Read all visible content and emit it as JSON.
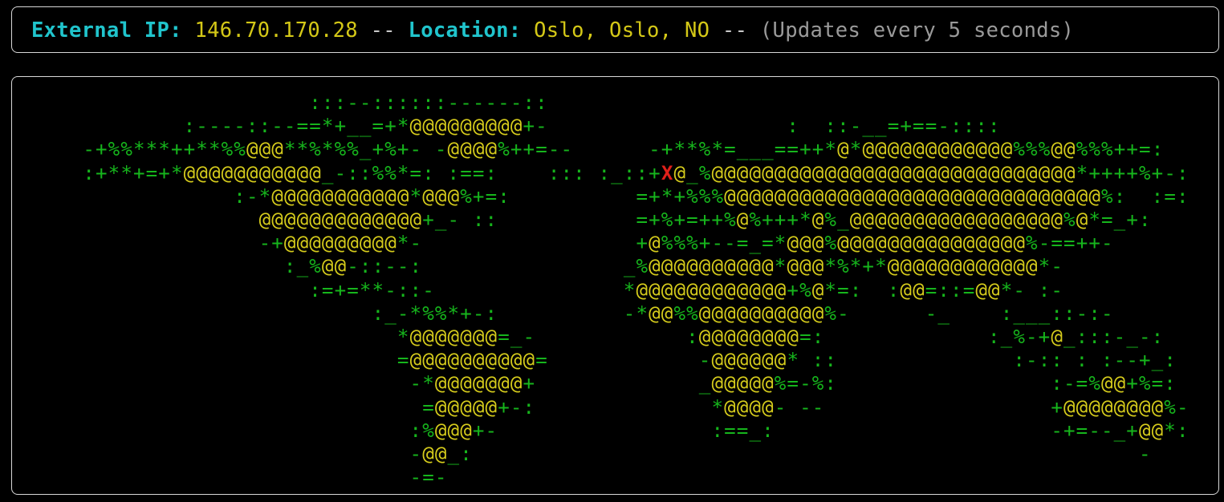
{
  "status": {
    "ip_label": "External IP:",
    "ip_value": "146.70.170.28",
    "separator": "--",
    "location_label": "Location:",
    "location_value": "Oslo, Oslo, NO",
    "separator2": "--",
    "update_note": "(Updates every 5 seconds)"
  },
  "map": {
    "marker": "X",
    "lines": [
      "                    :::--::::::------::",
      "          :----::--==*+__=+*@@@@@@@@@+-                   :  ::-__=+==-::::",
      "  -+%%***++**%%@@@**%*%%_+%+- -@@@@%++=--      -+**%*=___==++*@*@@@@@@@@@@@@%%%@@%%%++=:",
      "  :+**+=+*@@@@@@@@@@@_-::%%*=: :==:    ::: :_::+X@_%@@@@@@@@@@@@@@@@@@@@@@@@@@@@@*++++%+-:",
      "              :-*@@@@@@@@@@@*@@@%+=:          =+*+%%%@@@@@@@@@@@@@@@@@@@@@@@@@@@@@@%:  :=:",
      "                @@@@@@@@@@@@@+_- ::           =+%+=++%@%+++*@%_@@@@@@@@@@@@@@@@@%@*=_+:",
      "                -+@@@@@@@@@*-                 +@%%%+--=_=*@@@%@@@@@@@@@@@@@@@%-==++-",
      "                  :_%@@-::--:                _%@@@@@@@@@@*@@@*%*+*@@@@@@@@@@@@*-",
      "                    :=+=**-::-               *@@@@@@@@@@@@+%@*=:  :@@=::=@@*- :-",
      "                         :_-*%%*+-:          -*@@%%@@@@@@@@@@%-      -_    :___::-:-",
      "                           *@@@@@@@=_-            :@@@@@@@@=:             :_%-+@_:::-_-:",
      "                           =@@@@@@@@@@=            -@@@@@@* ::              :-:: : :--+_:",
      "                            -*@@@@@@@+             _@@@@@%=-%:                 :-=%@@+%=:",
      "                             =@@@@@+-:              *@@@@- --                  +@@@@@@@@%-",
      "                            :%@@@+-                 :==_:                      -+=--_+@@*:",
      "                            -@@_:                                                     -",
      "                            -=-"
    ]
  }
}
